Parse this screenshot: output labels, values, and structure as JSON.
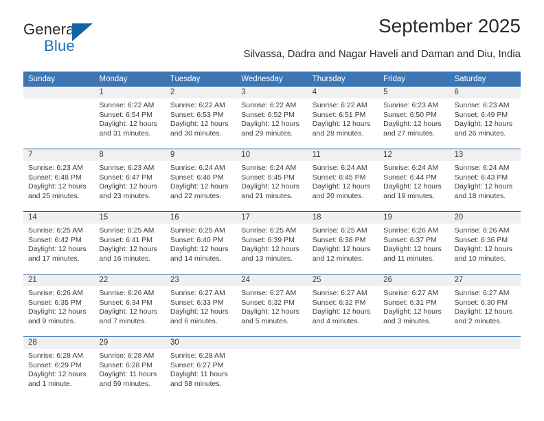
{
  "brand": {
    "name_top": "General",
    "name_bottom": "Blue",
    "accent_color": "#1464a5",
    "text_color": "#27282a"
  },
  "header": {
    "title": "September 2025",
    "subtitle": "Silvassa, Dadra and Nagar Haveli and Daman and Diu, India"
  },
  "theme": {
    "header_row_bg": "#3d76b4",
    "header_row_text": "#ffffff",
    "daynum_band_bg": "#f0f0f0",
    "week_separator": "#1f5fa6",
    "body_text": "#3c3c3c"
  },
  "calendar": {
    "weekday_headers": [
      "Sunday",
      "Monday",
      "Tuesday",
      "Wednesday",
      "Thursday",
      "Friday",
      "Saturday"
    ],
    "weeks": [
      [
        {
          "day": "",
          "sunrise": "",
          "sunset": "",
          "daylight_line1": "",
          "daylight_line2": ""
        },
        {
          "day": "1",
          "sunrise": "Sunrise: 6:22 AM",
          "sunset": "Sunset: 6:54 PM",
          "daylight_line1": "Daylight: 12 hours",
          "daylight_line2": "and 31 minutes."
        },
        {
          "day": "2",
          "sunrise": "Sunrise: 6:22 AM",
          "sunset": "Sunset: 6:53 PM",
          "daylight_line1": "Daylight: 12 hours",
          "daylight_line2": "and 30 minutes."
        },
        {
          "day": "3",
          "sunrise": "Sunrise: 6:22 AM",
          "sunset": "Sunset: 6:52 PM",
          "daylight_line1": "Daylight: 12 hours",
          "daylight_line2": "and 29 minutes."
        },
        {
          "day": "4",
          "sunrise": "Sunrise: 6:22 AM",
          "sunset": "Sunset: 6:51 PM",
          "daylight_line1": "Daylight: 12 hours",
          "daylight_line2": "and 28 minutes."
        },
        {
          "day": "5",
          "sunrise": "Sunrise: 6:23 AM",
          "sunset": "Sunset: 6:50 PM",
          "daylight_line1": "Daylight: 12 hours",
          "daylight_line2": "and 27 minutes."
        },
        {
          "day": "6",
          "sunrise": "Sunrise: 6:23 AM",
          "sunset": "Sunset: 6:49 PM",
          "daylight_line1": "Daylight: 12 hours",
          "daylight_line2": "and 26 minutes."
        }
      ],
      [
        {
          "day": "7",
          "sunrise": "Sunrise: 6:23 AM",
          "sunset": "Sunset: 6:48 PM",
          "daylight_line1": "Daylight: 12 hours",
          "daylight_line2": "and 25 minutes."
        },
        {
          "day": "8",
          "sunrise": "Sunrise: 6:23 AM",
          "sunset": "Sunset: 6:47 PM",
          "daylight_line1": "Daylight: 12 hours",
          "daylight_line2": "and 23 minutes."
        },
        {
          "day": "9",
          "sunrise": "Sunrise: 6:24 AM",
          "sunset": "Sunset: 6:46 PM",
          "daylight_line1": "Daylight: 12 hours",
          "daylight_line2": "and 22 minutes."
        },
        {
          "day": "10",
          "sunrise": "Sunrise: 6:24 AM",
          "sunset": "Sunset: 6:45 PM",
          "daylight_line1": "Daylight: 12 hours",
          "daylight_line2": "and 21 minutes."
        },
        {
          "day": "11",
          "sunrise": "Sunrise: 6:24 AM",
          "sunset": "Sunset: 6:45 PM",
          "daylight_line1": "Daylight: 12 hours",
          "daylight_line2": "and 20 minutes."
        },
        {
          "day": "12",
          "sunrise": "Sunrise: 6:24 AM",
          "sunset": "Sunset: 6:44 PM",
          "daylight_line1": "Daylight: 12 hours",
          "daylight_line2": "and 19 minutes."
        },
        {
          "day": "13",
          "sunrise": "Sunrise: 6:24 AM",
          "sunset": "Sunset: 6:43 PM",
          "daylight_line1": "Daylight: 12 hours",
          "daylight_line2": "and 18 minutes."
        }
      ],
      [
        {
          "day": "14",
          "sunrise": "Sunrise: 6:25 AM",
          "sunset": "Sunset: 6:42 PM",
          "daylight_line1": "Daylight: 12 hours",
          "daylight_line2": "and 17 minutes."
        },
        {
          "day": "15",
          "sunrise": "Sunrise: 6:25 AM",
          "sunset": "Sunset: 6:41 PM",
          "daylight_line1": "Daylight: 12 hours",
          "daylight_line2": "and 16 minutes."
        },
        {
          "day": "16",
          "sunrise": "Sunrise: 6:25 AM",
          "sunset": "Sunset: 6:40 PM",
          "daylight_line1": "Daylight: 12 hours",
          "daylight_line2": "and 14 minutes."
        },
        {
          "day": "17",
          "sunrise": "Sunrise: 6:25 AM",
          "sunset": "Sunset: 6:39 PM",
          "daylight_line1": "Daylight: 12 hours",
          "daylight_line2": "and 13 minutes."
        },
        {
          "day": "18",
          "sunrise": "Sunrise: 6:25 AM",
          "sunset": "Sunset: 6:38 PM",
          "daylight_line1": "Daylight: 12 hours",
          "daylight_line2": "and 12 minutes."
        },
        {
          "day": "19",
          "sunrise": "Sunrise: 6:26 AM",
          "sunset": "Sunset: 6:37 PM",
          "daylight_line1": "Daylight: 12 hours",
          "daylight_line2": "and 11 minutes."
        },
        {
          "day": "20",
          "sunrise": "Sunrise: 6:26 AM",
          "sunset": "Sunset: 6:36 PM",
          "daylight_line1": "Daylight: 12 hours",
          "daylight_line2": "and 10 minutes."
        }
      ],
      [
        {
          "day": "21",
          "sunrise": "Sunrise: 6:26 AM",
          "sunset": "Sunset: 6:35 PM",
          "daylight_line1": "Daylight: 12 hours",
          "daylight_line2": "and 9 minutes."
        },
        {
          "day": "22",
          "sunrise": "Sunrise: 6:26 AM",
          "sunset": "Sunset: 6:34 PM",
          "daylight_line1": "Daylight: 12 hours",
          "daylight_line2": "and 7 minutes."
        },
        {
          "day": "23",
          "sunrise": "Sunrise: 6:27 AM",
          "sunset": "Sunset: 6:33 PM",
          "daylight_line1": "Daylight: 12 hours",
          "daylight_line2": "and 6 minutes."
        },
        {
          "day": "24",
          "sunrise": "Sunrise: 6:27 AM",
          "sunset": "Sunset: 6:32 PM",
          "daylight_line1": "Daylight: 12 hours",
          "daylight_line2": "and 5 minutes."
        },
        {
          "day": "25",
          "sunrise": "Sunrise: 6:27 AM",
          "sunset": "Sunset: 6:32 PM",
          "daylight_line1": "Daylight: 12 hours",
          "daylight_line2": "and 4 minutes."
        },
        {
          "day": "26",
          "sunrise": "Sunrise: 6:27 AM",
          "sunset": "Sunset: 6:31 PM",
          "daylight_line1": "Daylight: 12 hours",
          "daylight_line2": "and 3 minutes."
        },
        {
          "day": "27",
          "sunrise": "Sunrise: 6:27 AM",
          "sunset": "Sunset: 6:30 PM",
          "daylight_line1": "Daylight: 12 hours",
          "daylight_line2": "and 2 minutes."
        }
      ],
      [
        {
          "day": "28",
          "sunrise": "Sunrise: 6:28 AM",
          "sunset": "Sunset: 6:29 PM",
          "daylight_line1": "Daylight: 12 hours",
          "daylight_line2": "and 1 minute."
        },
        {
          "day": "29",
          "sunrise": "Sunrise: 6:28 AM",
          "sunset": "Sunset: 6:28 PM",
          "daylight_line1": "Daylight: 11 hours",
          "daylight_line2": "and 59 minutes."
        },
        {
          "day": "30",
          "sunrise": "Sunrise: 6:28 AM",
          "sunset": "Sunset: 6:27 PM",
          "daylight_line1": "Daylight: 11 hours",
          "daylight_line2": "and 58 minutes."
        },
        {
          "day": "",
          "sunrise": "",
          "sunset": "",
          "daylight_line1": "",
          "daylight_line2": ""
        },
        {
          "day": "",
          "sunrise": "",
          "sunset": "",
          "daylight_line1": "",
          "daylight_line2": ""
        },
        {
          "day": "",
          "sunrise": "",
          "sunset": "",
          "daylight_line1": "",
          "daylight_line2": ""
        },
        {
          "day": "",
          "sunrise": "",
          "sunset": "",
          "daylight_line1": "",
          "daylight_line2": ""
        }
      ]
    ]
  }
}
